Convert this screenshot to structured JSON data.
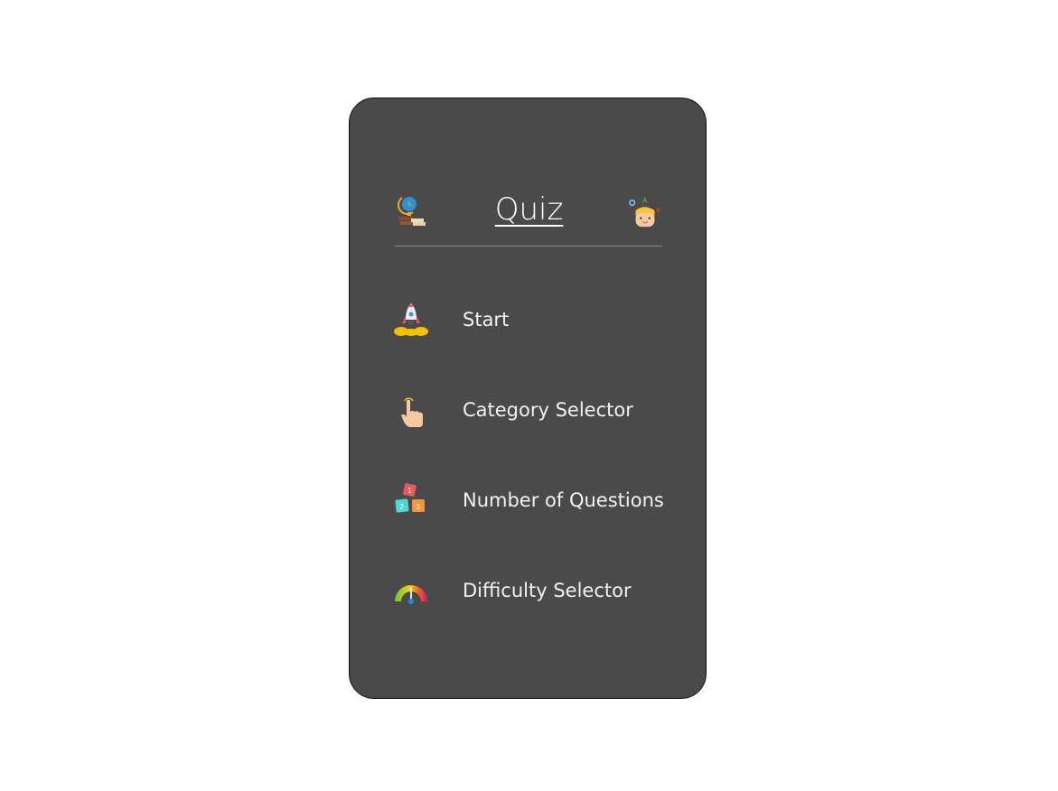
{
  "header": {
    "title": "Quiz",
    "left_icon": "globe-books-icon",
    "right_icon": "thinking-kid-icon"
  },
  "menu": {
    "items": [
      {
        "label": "Start",
        "icon": "rocket-icon"
      },
      {
        "label": "Category Selector",
        "icon": "pointing-hand-icon"
      },
      {
        "label": "Number of Questions",
        "icon": "number-blocks-icon"
      },
      {
        "label": "Difficulty Selector",
        "icon": "gauge-icon"
      }
    ]
  },
  "colors": {
    "card_background": "#4a4a4a",
    "text": "#f2f2f2",
    "divider": "#8a8a8a"
  }
}
